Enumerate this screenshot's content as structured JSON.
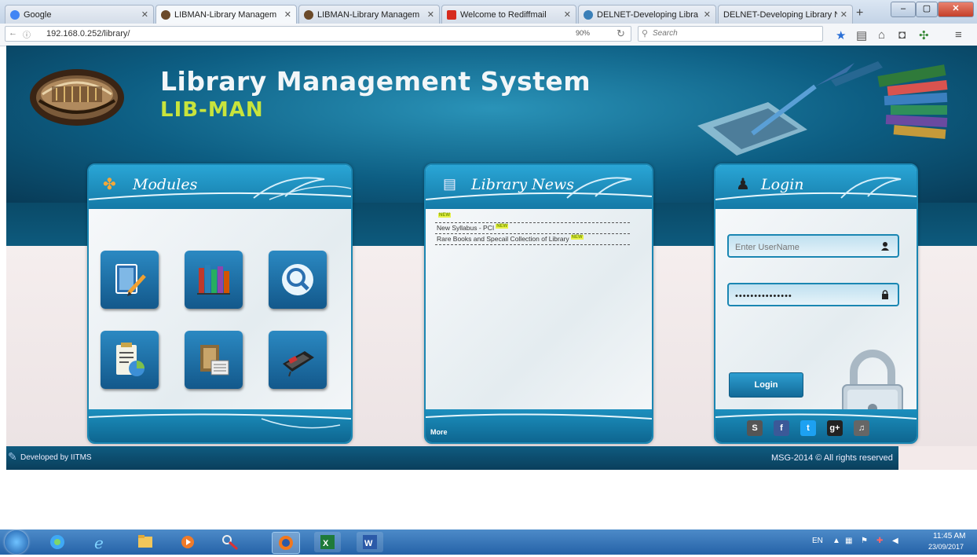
{
  "browser": {
    "tabs": [
      {
        "label": "Google",
        "active": false
      },
      {
        "label": "LIBMAN-Library Managem",
        "active": true
      },
      {
        "label": "LIBMAN-Library Managem",
        "active": false
      },
      {
        "label": "Welcome to Rediffmail",
        "active": false
      },
      {
        "label": "DELNET-Developing Libra",
        "active": false
      },
      {
        "label": "DELNET-Developing Library N",
        "active": false
      }
    ],
    "url": "192.168.0.252/library/",
    "zoom": "90%",
    "search_placeholder": "Search"
  },
  "site": {
    "title": "Library Management System",
    "subtitle": "LIB-MAN"
  },
  "modules": {
    "title": "Modules",
    "icons": [
      "notebook-pen-icon",
      "bookshelf-icon",
      "magnifier-icon",
      "report-chart-icon",
      "books-newspaper-icon",
      "scanner-icon"
    ]
  },
  "news": {
    "title": "Library News",
    "items": [
      {
        "text": "",
        "new_badge": "NEW"
      },
      {
        "text": "New Syllabus - PCI",
        "new_badge": "NEW"
      },
      {
        "text": "Rare Books and Specail Collection of Library",
        "new_badge": "NEW"
      }
    ],
    "more": "More"
  },
  "login": {
    "title": "Login",
    "username_placeholder": "Enter UserName",
    "password_value": "•••••••••••••••",
    "button": "Login",
    "social": [
      "S",
      "f",
      "t",
      "g+",
      "♫"
    ]
  },
  "footer": {
    "left": "Developed by IITMS",
    "right": "MSG-2014 © All rights reserved"
  },
  "taskbar": {
    "lang": "EN",
    "time": "11:45 AM",
    "date": "23/09/2017"
  },
  "colors": {
    "header_blue": "#0d5e83",
    "accent_green": "#c8e43c",
    "panel_border": "#1a86b2"
  }
}
